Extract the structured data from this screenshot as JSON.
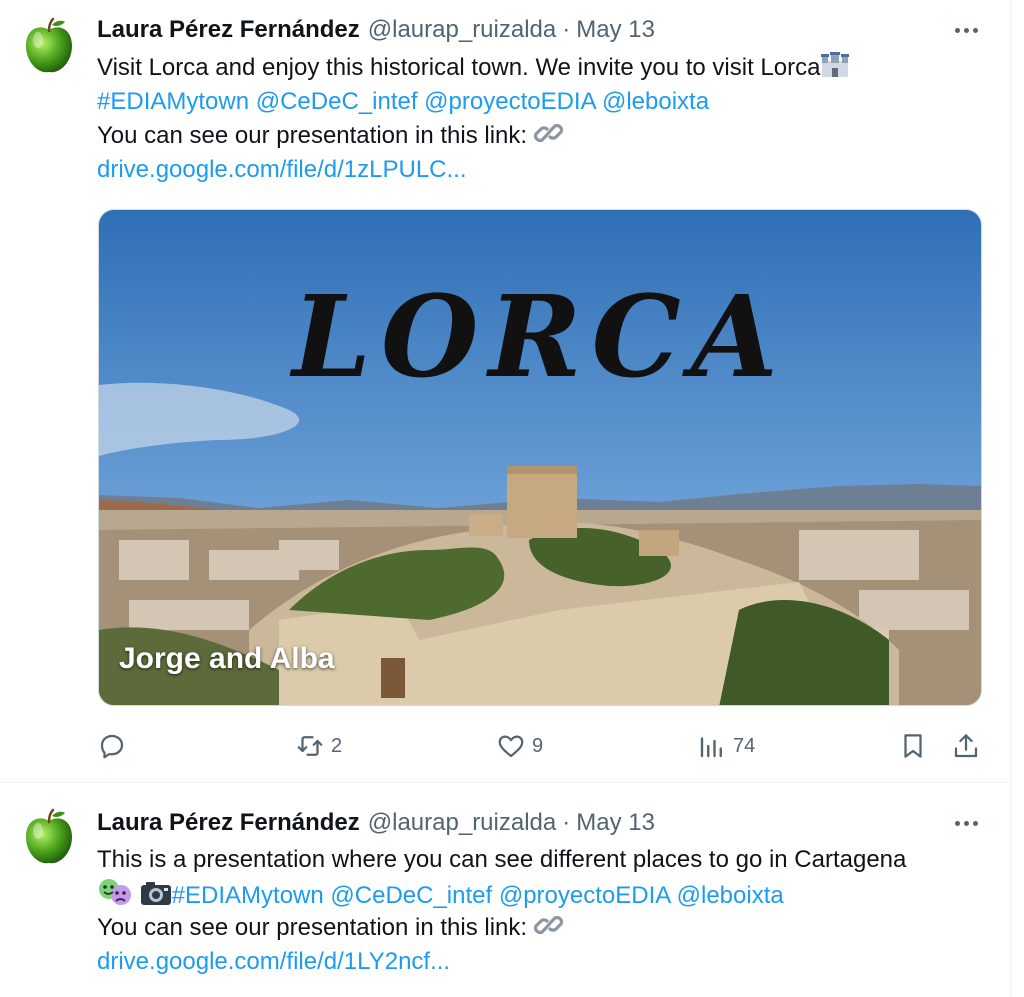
{
  "tweets": [
    {
      "author_name": "Laura Pérez Fernández",
      "handle": "@laurap_ruizalda",
      "separator": "·",
      "date": "May 13",
      "text_line_1": "Visit Lorca and enjoy this historical town. We invite you to visit Lorca",
      "hashtag": "#EDIAMytown",
      "mentions": [
        "@CeDeC_intef",
        "@proyectoEDIA",
        "@leboixta"
      ],
      "text_line_3": "You can see our presentation in this link:",
      "url": "drive.google.com/file/d/1zLPULC...",
      "media": {
        "title": "LORCA",
        "caption": "Jorge and Alba"
      },
      "actions": {
        "replies": "",
        "retweets": "2",
        "likes": "9",
        "views": "74"
      }
    },
    {
      "author_name": "Laura Pérez Fernández",
      "handle": "@laurap_ruizalda",
      "separator": "·",
      "date": "May 13",
      "text_line_1": "This is a presentation where you can see different places to go in Cartagena",
      "hashtag": "#EDIAMytown",
      "mentions": [
        "@CeDeC_intef",
        "@proyectoEDIA",
        "@leboixta"
      ],
      "text_line_3": "You can see our presentation in this link:",
      "url": "drive.google.com/file/d/1LY2ncf..."
    }
  ],
  "icons": {
    "avatar": "green-apple-icon",
    "more": "more-options-icon",
    "link": "link-icon",
    "castle": "castle-icon",
    "masks": "theater-masks-icon",
    "camera": "camera-icon",
    "reply": "reply-icon",
    "retweet": "retweet-icon",
    "like": "like-icon",
    "views": "views-icon",
    "bookmark": "bookmark-icon",
    "share": "share-icon"
  },
  "colors": {
    "link": "#1d9bf0",
    "muted": "#536471",
    "text": "#0f1419"
  }
}
